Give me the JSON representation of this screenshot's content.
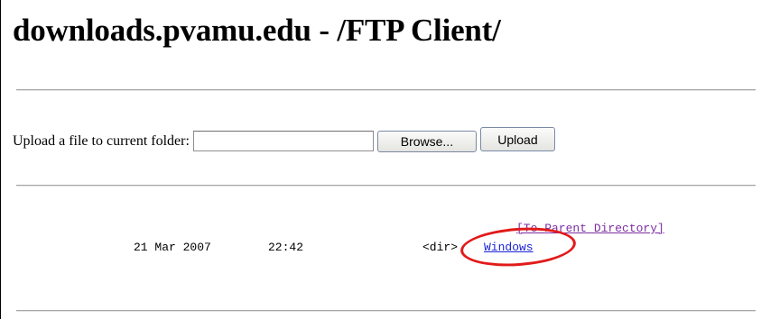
{
  "page": {
    "title": "downloads.pvamu.edu - /FTP Client/"
  },
  "upload": {
    "label": "Upload a file to current folder:",
    "file_value": "",
    "browse_label": "Browse...",
    "upload_label": "Upload"
  },
  "listing": {
    "parent_link": "[To Parent Directory]",
    "entries": [
      {
        "date": "21 Mar 2007",
        "time": "22:42",
        "type": "<dir>",
        "name": "Windows"
      }
    ]
  },
  "annotation": {
    "color": "#e21a1a",
    "target": "Windows"
  },
  "colors": {
    "link": "#1a24d6",
    "visited_link": "#7b2da1"
  }
}
